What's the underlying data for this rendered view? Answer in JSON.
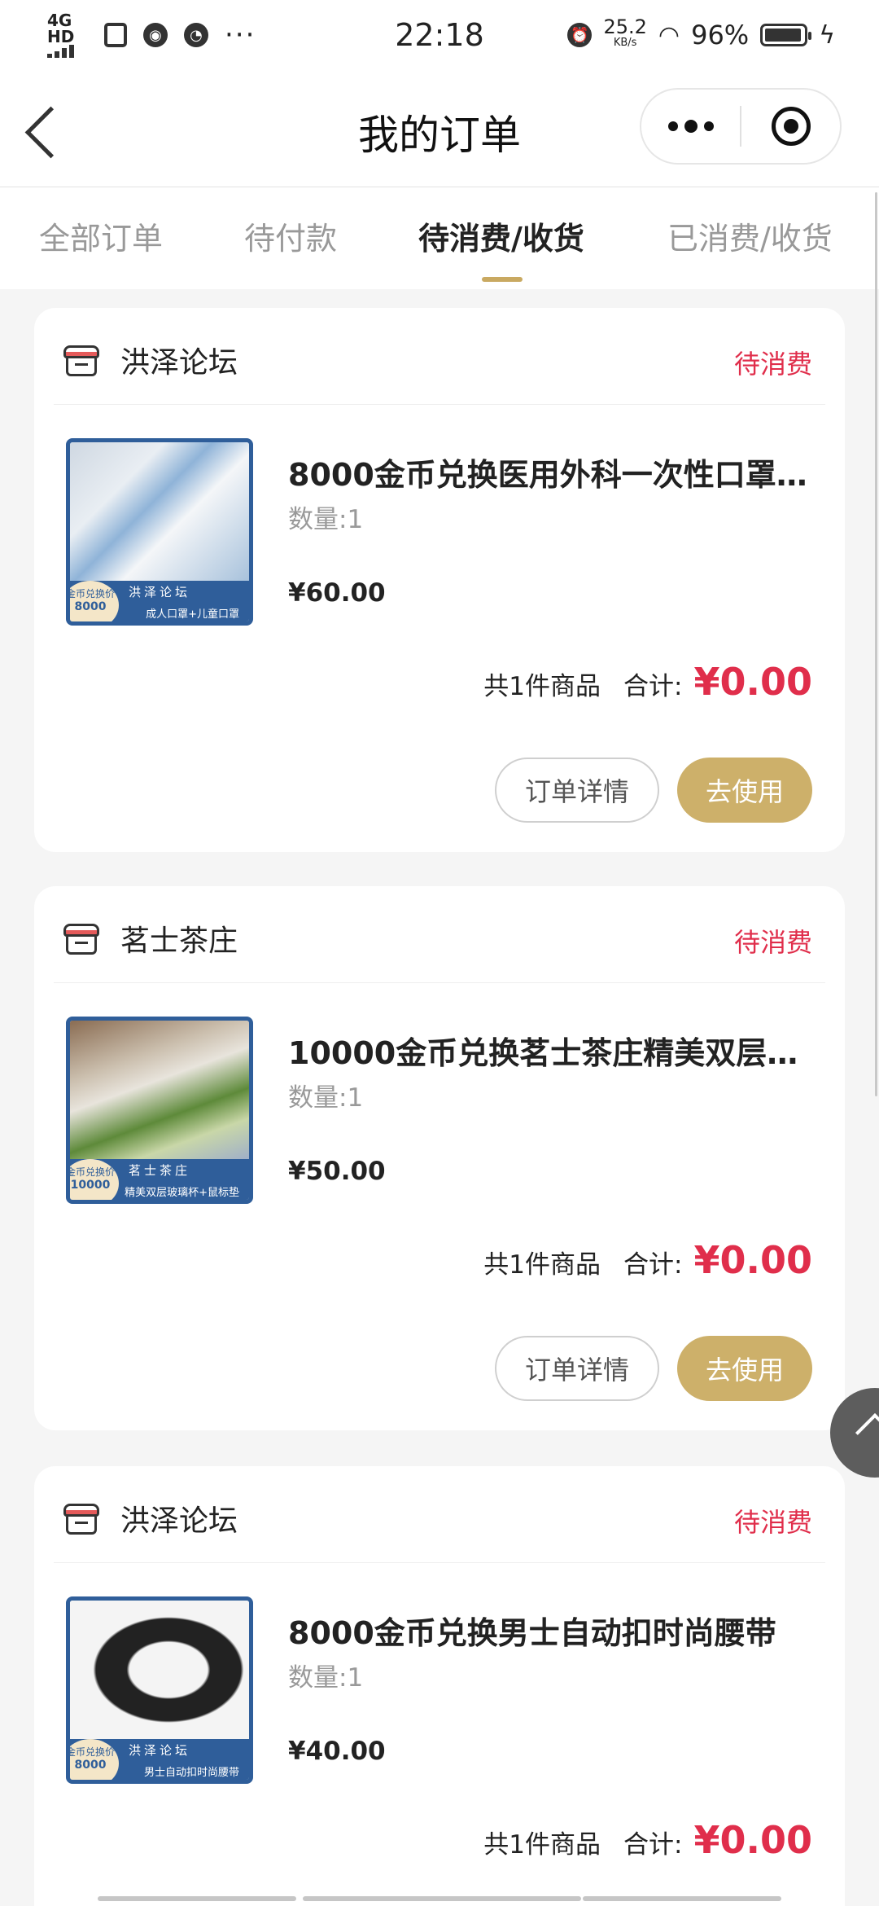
{
  "status_bar": {
    "network": "4G HD",
    "time": "22:18",
    "speed_value": "25.2",
    "speed_unit": "KB/s",
    "battery": "96%",
    "battery_level": 0.96
  },
  "nav": {
    "title": "我的订单"
  },
  "tabs": [
    {
      "label": "全部订单",
      "active": false
    },
    {
      "label": "待付款",
      "active": false
    },
    {
      "label": "待消费/收货",
      "active": true
    },
    {
      "label": "已消费/收货",
      "active": false
    }
  ],
  "orders": [
    {
      "shop": "洪泽论坛",
      "status": "待消费",
      "title": "8000金币兑换医用外科一次性口罩…",
      "qty": "数量:1",
      "price": "¥60.00",
      "count": "共1件商品",
      "total_label": "合计:",
      "total": "¥0.00",
      "detail_btn": "订单详情",
      "use_btn": "去使用",
      "thumb_band": "洪泽论坛",
      "thumb_sub": "成人口罩+儿童口罩",
      "thumb_badge_top": "金币兑换价",
      "thumb_badge_value": "8000"
    },
    {
      "shop": "茗士茶庄",
      "status": "待消费",
      "title": "10000金币兑换茗士茶庄精美双层…",
      "qty": "数量:1",
      "price": "¥50.00",
      "count": "共1件商品",
      "total_label": "合计:",
      "total": "¥0.00",
      "detail_btn": "订单详情",
      "use_btn": "去使用",
      "thumb_band": "茗士茶庄",
      "thumb_sub": "精美双层玻璃杯+鼠标垫",
      "thumb_badge_top": "金币兑换价",
      "thumb_badge_value": "10000"
    },
    {
      "shop": "洪泽论坛",
      "status": "待消费",
      "title": "8000金币兑换男士自动扣时尚腰带",
      "qty": "数量:1",
      "price": "¥40.00",
      "count": "共1件商品",
      "total_label": "合计:",
      "total": "¥0.00",
      "thumb_band": "洪泽论坛",
      "thumb_sub": "男士自动扣时尚腰带",
      "thumb_badge_top": "金币兑换价",
      "thumb_badge_value": "8000"
    }
  ],
  "colors": {
    "accent_gold": "#cdb06a",
    "status_red": "#e02e4b",
    "thumb_blue": "#2f5e9a"
  }
}
